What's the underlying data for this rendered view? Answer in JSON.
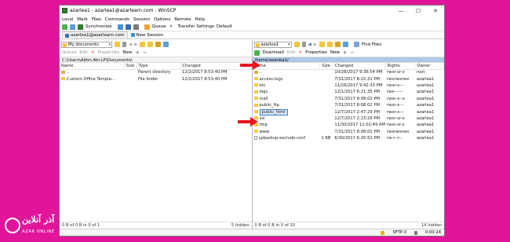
{
  "window": {
    "title": "azarlea1 - azarlea1@azarlearn.com - WinSCP",
    "controls": [
      "—",
      "☐",
      "✕"
    ]
  },
  "menu": [
    "Local",
    "Mark",
    "Files",
    "Commands",
    "Session",
    "Options",
    "Remote",
    "Help"
  ],
  "toolbar": {
    "synchronize": "Synchronize",
    "queue": "Queue",
    "transfer_settings": "Transfer Settings",
    "transfer_value": "Default"
  },
  "session_tab": "azarlea1@azarlearn.com",
  "new_session": "New Session",
  "left": {
    "location": "My documents",
    "upload": "Upload",
    "edit": "Edit",
    "properties": "Properties",
    "new": "New",
    "path": "C:\\Users\\Abtin.Abi-LP\\Documents\\",
    "columns": [
      "Name",
      "Size",
      "Type",
      "Changed"
    ],
    "rows": [
      {
        "name": "..",
        "size": "",
        "type": "Parent directory",
        "changed": "12/2/2017 8:53:40 PM"
      },
      {
        "name": "Custom Office Templa...",
        "size": "",
        "type": "File folder",
        "changed": "12/2/2017 8:53:40 PM"
      }
    ],
    "footer_left": "0 B of 0 B in 0 of 1",
    "footer_right": "5 hidden"
  },
  "right": {
    "location": "azarlea1",
    "download": "Download",
    "edit": "Edit",
    "properties": "Properties",
    "new": "New",
    "find_files": "Find Files",
    "path": "/home/azarlea1/",
    "columns": [
      "Name",
      "Size",
      "Changed",
      "Rights",
      "Owner"
    ],
    "rows": [
      {
        "name": "..",
        "size": "",
        "changed": "10/28/2017 9:36:54 PM",
        "rights": "rwxr-xr-x",
        "owner": "root"
      },
      {
        "name": "access-logs",
        "size": "",
        "changed": "7/31/2017 8:22:31 PM",
        "rights": "rwxrwxrwx",
        "owner": "azarlea1"
      },
      {
        "name": "etc",
        "size": "",
        "changed": "11/26/2017 9:42:33 PM",
        "rights": "rwxr-x---",
        "owner": "azarlea1"
      },
      {
        "name": "logs",
        "size": "",
        "changed": "12/1/2017 6:21:35 PM",
        "rights": "rwx------",
        "owner": "azarlea1"
      },
      {
        "name": "mail",
        "size": "",
        "changed": "7/31/2017 8:08:02 PM",
        "rights": "rwxr-x--x",
        "owner": "azarlea1"
      },
      {
        "name": "public_ftp",
        "size": "",
        "changed": "7/31/2017 8:08:02 PM",
        "rights": "rwxr-x---",
        "owner": "azarlea1"
      },
      {
        "name": "public_html",
        "size": "",
        "changed": "12/7/2017 2:47:29 PM",
        "rights": "rwxr-x---",
        "owner": "azarlea1"
      },
      {
        "name": "ssl",
        "size": "",
        "changed": "12/7/2017 2:23:29 PM",
        "rights": "rwxr-xr-x",
        "owner": "azarlea1"
      },
      {
        "name": "tmp",
        "size": "",
        "changed": "11/30/2017 11:02:49 AM",
        "rights": "rwxr-xr-x",
        "owner": "azarlea1"
      },
      {
        "name": "www",
        "size": "",
        "changed": "7/31/2017 8:08:02 PM",
        "rights": "rwxrwxrwx",
        "owner": "azarlea1"
      },
      {
        "name": "cpbackup-exclude.conf",
        "size": "1 KB",
        "changed": "6/30/2017 6:20:52 PM",
        "rights": "rw-r--r--",
        "owner": "azarlea1"
      }
    ],
    "selected_index": 6,
    "footer_left": "0 B of 0 B in 0 of 10",
    "footer_right": "14 hidden"
  },
  "status": {
    "protocol": "SFTP-3",
    "time": "0:00:24"
  },
  "watermark": {
    "brand": "آذر آنلاین",
    "sub": "AZAR ONLINE"
  },
  "colors": {
    "background": "#e0159a",
    "arrow": "#e8141c",
    "path_active": "#aec8e6"
  }
}
